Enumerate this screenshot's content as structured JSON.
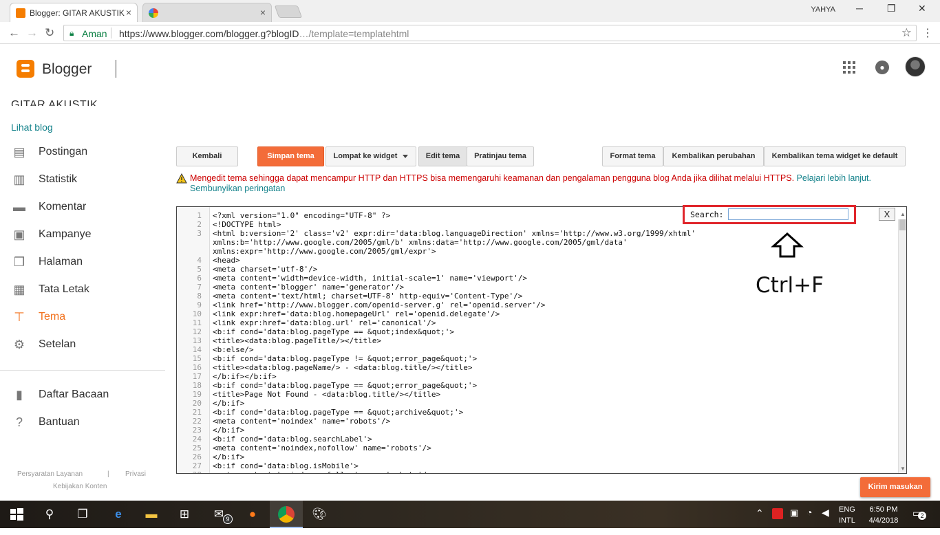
{
  "browser": {
    "tabs": [
      {
        "title": "Blogger: GITAR AKUSTIK",
        "active": true
      },
      {
        "title": "",
        "active": false
      }
    ],
    "window_user": "YAHYA",
    "secure_label": "Aman",
    "url_main": "https://www.blogger.com/blogger.g?blogID",
    "url_rest": "…/template",
    "url_suffix": "=templatehtml"
  },
  "header": {
    "brand": "Blogger"
  },
  "sidebar": {
    "blog_title": "GITAR AKUSTIK",
    "view_blog": "Lihat blog",
    "items": [
      {
        "label": "Postingan",
        "icon": "posts-icon"
      },
      {
        "label": "Statistik",
        "icon": "stats-icon"
      },
      {
        "label": "Komentar",
        "icon": "comments-icon"
      },
      {
        "label": "Kampanye",
        "icon": "campaign-icon"
      },
      {
        "label": "Halaman",
        "icon": "pages-icon"
      },
      {
        "label": "Tata Letak",
        "icon": "layout-icon"
      },
      {
        "label": "Tema",
        "icon": "theme-icon",
        "active": true
      },
      {
        "label": "Setelan",
        "icon": "settings-icon"
      }
    ],
    "secondary": [
      {
        "label": "Daftar Bacaan",
        "icon": "reading-list-icon"
      },
      {
        "label": "Bantuan",
        "icon": "help-icon"
      }
    ],
    "footer": {
      "terms": "Persyaratan Layanan",
      "privacy": "Privasi",
      "content_policy": "Kebijakan Konten"
    }
  },
  "toolbar": {
    "back": "Kembali",
    "save": "Simpan tema",
    "jump": "Lompat ke widget",
    "edit": "Edit tema",
    "preview": "Pratinjau tema",
    "format": "Format tema",
    "revert": "Kembalikan perubahan",
    "revert_widgets": "Kembalikan tema widget ke default"
  },
  "warning": {
    "text": "Mengedit tema sehingga dapat mencampur HTTP dan HTTPS bisa memengaruhi keamanan dan pengalaman pengguna blog Anda jika dilihat melalui HTTPS.",
    "learn_more": "Pelajari lebih lanjut.",
    "hide": "Sembunyikan peringatan"
  },
  "editor": {
    "search_label": "Search:",
    "search_value": "",
    "close": "X",
    "lines": [
      {
        "n": "1",
        "text": "<?xml version=\"1.0\" encoding=\"UTF-8\" ?>"
      },
      {
        "n": "2",
        "text": "<!DOCTYPE html>"
      },
      {
        "n": "3",
        "text": "<html b:version='2' class='v2' expr:dir='data:blog.languageDirection' xmlns='http://www.w3.org/1999/xhtml'\nxmlns:b='http://www.google.com/2005/gml/b' xmlns:data='http://www.google.com/2005/gml/data'\nxmlns:expr='http://www.google.com/2005/gml/expr'>"
      },
      {
        "n": "4",
        "text": "<head>"
      },
      {
        "n": "5",
        "text": "<meta charset='utf-8'/>"
      },
      {
        "n": "6",
        "text": "<meta content='width=device-width, initial-scale=1' name='viewport'/>"
      },
      {
        "n": "7",
        "text": "<meta content='blogger' name='generator'/>"
      },
      {
        "n": "8",
        "text": "<meta content='text/html; charset=UTF-8' http-equiv='Content-Type'/>"
      },
      {
        "n": "9",
        "text": "<link href='http://www.blogger.com/openid-server.g' rel='openid.server'/>"
      },
      {
        "n": "10",
        "text": "<link expr:href='data:blog.homepageUrl' rel='openid.delegate'/>"
      },
      {
        "n": "11",
        "text": "<link expr:href='data:blog.url' rel='canonical'/>"
      },
      {
        "n": "12",
        "text": "<b:if cond='data:blog.pageType == &quot;index&quot;'>"
      },
      {
        "n": "13",
        "text": "<title><data:blog.pageTitle/></title>"
      },
      {
        "n": "14",
        "text": "<b:else/>"
      },
      {
        "n": "15",
        "text": "<b:if cond='data:blog.pageType != &quot;error_page&quot;'>"
      },
      {
        "n": "16",
        "text": "<title><data:blog.pageName/> - <data:blog.title/></title>"
      },
      {
        "n": "17",
        "text": "</b:if></b:if>"
      },
      {
        "n": "18",
        "text": "<b:if cond='data:blog.pageType == &quot;error_page&quot;'>"
      },
      {
        "n": "19",
        "text": "<title>Page Not Found - <data:blog.title/></title>"
      },
      {
        "n": "20",
        "text": "</b:if>"
      },
      {
        "n": "21",
        "text": "<b:if cond='data:blog.pageType == &quot;archive&quot;'>"
      },
      {
        "n": "22",
        "text": "<meta content='noindex' name='robots'/>"
      },
      {
        "n": "23",
        "text": "</b:if>"
      },
      {
        "n": "24",
        "text": "<b:if cond='data:blog.searchLabel'>"
      },
      {
        "n": "25",
        "text": "<meta content='noindex,nofollow' name='robots'/>"
      },
      {
        "n": "26",
        "text": "</b:if>"
      },
      {
        "n": "27",
        "text": "<b:if cond='data:blog.isMobile'>"
      },
      {
        "n": "28",
        "text": "<meta content='noindex,nofollow' name='robots'/>"
      }
    ]
  },
  "annotation": {
    "shortcut": "Ctrl+F"
  },
  "feedback": "Kirim masukan",
  "taskbar": {
    "mail_badge": "9",
    "language": "ENG",
    "language_sub": "INTL",
    "time": "6:50 PM",
    "date": "4/4/2018",
    "notification_count": "2"
  },
  "colors": {
    "accent": "#f36c39",
    "link": "#14828b",
    "warning": "#cc0000",
    "search_highlight": "#e0262c"
  }
}
